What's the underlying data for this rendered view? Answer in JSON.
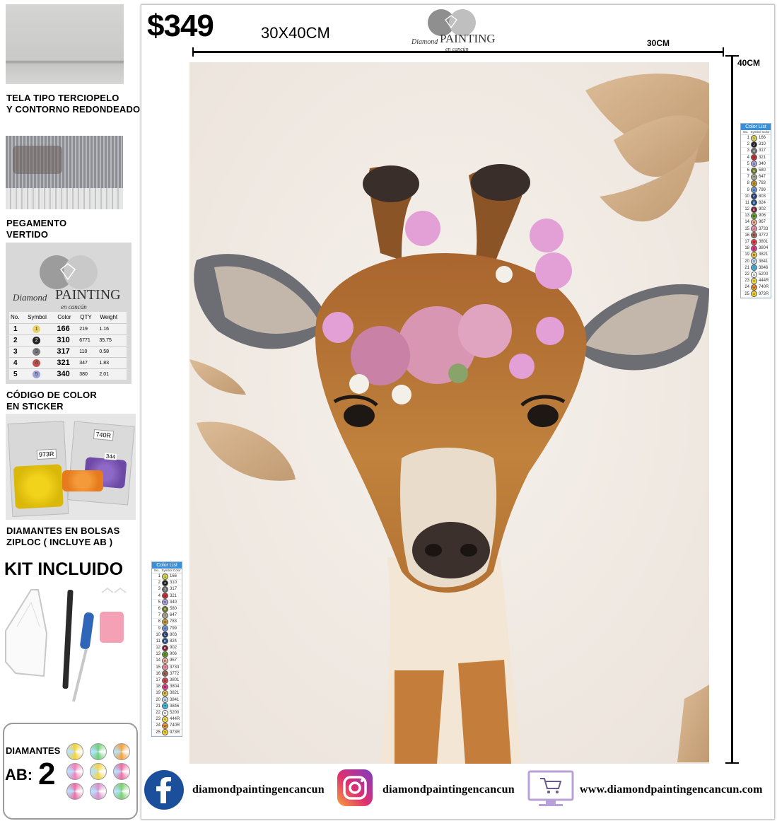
{
  "price": "$349",
  "size_label": "30X40CM",
  "width_label": "30CM",
  "height_label": "40CM",
  "brand": {
    "line1": "Diamond",
    "line2": "PAINTING",
    "line3": "en cancún"
  },
  "features": [
    {
      "caption_line1": "TELA TIPO TERCIOPELO",
      "caption_line2": "Y CONTORNO REDONDEADO"
    },
    {
      "caption_line1": "PEGAMENTO",
      "caption_line2": "VERTIDO"
    },
    {
      "caption_line1": "CÓDIGO DE COLOR",
      "caption_line2": "EN STICKER"
    },
    {
      "caption_line1": "DIAMANTES EN BOLSAS",
      "caption_line2": "ZIPLOC ( INCLUYE AB )"
    }
  ],
  "sticker_table": {
    "headers": [
      "No.",
      "Symbol",
      "Color",
      "QTY",
      "Weight"
    ],
    "rows": [
      {
        "no": "1",
        "sym": "1",
        "color": "166",
        "qty": "219",
        "weight": "1.16",
        "dot": "#e8d36a"
      },
      {
        "no": "2",
        "sym": "2",
        "color": "310",
        "qty": "6771",
        "weight": "35.75",
        "dot": "#222222"
      },
      {
        "no": "3",
        "sym": "3",
        "color": "317",
        "qty": "110",
        "weight": "0.58",
        "dot": "#7a7a80"
      },
      {
        "no": "4",
        "sym": "4",
        "color": "321",
        "qty": "347",
        "weight": "1.83",
        "dot": "#c0504d"
      },
      {
        "no": "5",
        "sym": "5",
        "color": "340",
        "qty": "380",
        "weight": "2.01",
        "dot": "#9aa0d8"
      }
    ]
  },
  "bags": {
    "tag1": "740R",
    "tag2": "973R",
    "tag3": "344"
  },
  "kit_title": "KIT INCLUIDO",
  "ab": {
    "line1": "DIAMANTES",
    "line2": "AB:",
    "count": "2"
  },
  "color_list": {
    "title": "Color List",
    "subheaders": [
      "No.",
      "Symbol",
      "Color"
    ],
    "rows": [
      {
        "no": "1",
        "sym": "1",
        "code": "166",
        "dot": "#d8d34a"
      },
      {
        "no": "2",
        "sym": "2",
        "code": "310",
        "dot": "#1e1e1e"
      },
      {
        "no": "3",
        "sym": "3",
        "code": "317",
        "dot": "#6d6f74"
      },
      {
        "no": "4",
        "sym": "4",
        "code": "321",
        "dot": "#c22f35"
      },
      {
        "no": "5",
        "sym": "5",
        "code": "340",
        "dot": "#a7a4e0"
      },
      {
        "no": "6",
        "sym": "6",
        "code": "580",
        "dot": "#6b7a22"
      },
      {
        "no": "7",
        "sym": "7",
        "code": "647",
        "dot": "#a8a58f"
      },
      {
        "no": "8",
        "sym": "8",
        "code": "783",
        "dot": "#c79a33"
      },
      {
        "no": "9",
        "sym": "A",
        "code": "799",
        "dot": "#6d95cf"
      },
      {
        "no": "10",
        "sym": "C",
        "code": "803",
        "dot": "#233c74"
      },
      {
        "no": "11",
        "sym": "D",
        "code": "824",
        "dot": "#1e4f86"
      },
      {
        "no": "12",
        "sym": "E",
        "code": "902",
        "dot": "#7a2233"
      },
      {
        "no": "13",
        "sym": "G",
        "code": "906",
        "dot": "#62a02b"
      },
      {
        "no": "14",
        "sym": "H",
        "code": "967",
        "dot": "#f1b39a"
      },
      {
        "no": "15",
        "sym": "J",
        "code": "3733",
        "dot": "#e78fa2"
      },
      {
        "no": "16",
        "sym": "K",
        "code": "3772",
        "dot": "#a06a57"
      },
      {
        "no": "17",
        "sym": "N",
        "code": "3801",
        "dot": "#e2464d"
      },
      {
        "no": "18",
        "sym": "O",
        "code": "3804",
        "dot": "#e03d8a"
      },
      {
        "no": "19",
        "sym": "R",
        "code": "3821",
        "dot": "#e8c447"
      },
      {
        "no": "20",
        "sym": "S",
        "code": "3841",
        "dot": "#c6dff0"
      },
      {
        "no": "21",
        "sym": "T",
        "code": "3846",
        "dot": "#3fb4e0"
      },
      {
        "no": "22",
        "sym": "U",
        "code": "5200",
        "dot": "#ffffff"
      },
      {
        "no": "23",
        "sym": "V",
        "code": "444R",
        "dot": "#f4e04a"
      },
      {
        "no": "24",
        "sym": "W",
        "code": "740R",
        "dot": "#f39a2e"
      },
      {
        "no": "25",
        "sym": "X",
        "code": "973R",
        "dot": "#f7d424"
      }
    ]
  },
  "footer": {
    "facebook": "diamondpaintingencancun",
    "instagram": "diamondpaintingencancun",
    "website": "www.diamondpaintingencancun.com"
  },
  "colors": {
    "facebook": "#1b4f9c",
    "instagram": "#d62d73",
    "art_bg": "#f3ece6",
    "gold": "#c9a57c"
  }
}
